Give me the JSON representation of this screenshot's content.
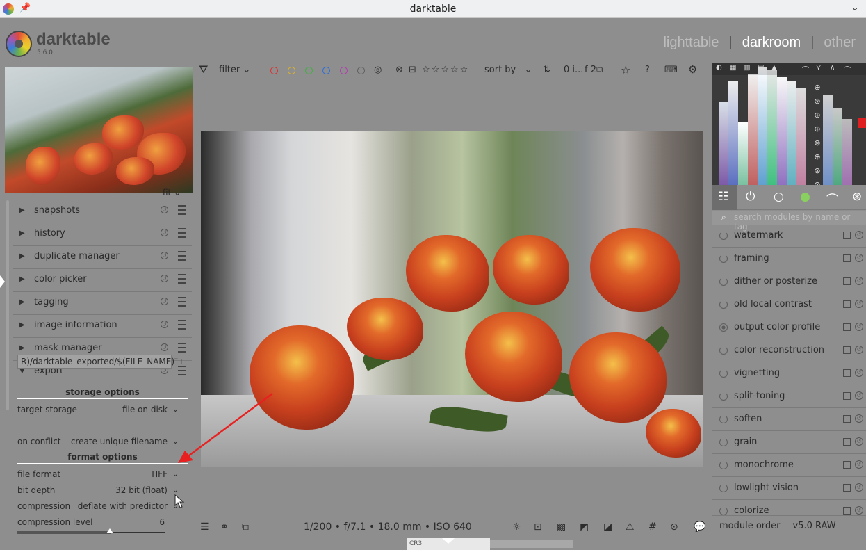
{
  "window": {
    "title": "darktable"
  },
  "app": {
    "brand": "darktable",
    "version": "5.6.0"
  },
  "views": {
    "lighttable": "lighttable",
    "darkroom": "darkroom",
    "other": "other",
    "separator": "|"
  },
  "thumbnail": {
    "zoom_label": "fit",
    "zoom_chevron": "⌄"
  },
  "left_modules": [
    {
      "label": "snapshots",
      "expanded": false
    },
    {
      "label": "history",
      "expanded": false
    },
    {
      "label": "duplicate manager",
      "expanded": false
    },
    {
      "label": "color picker",
      "expanded": false
    },
    {
      "label": "tagging",
      "expanded": false
    },
    {
      "label": "image information",
      "expanded": false
    },
    {
      "label": "mask manager",
      "expanded": false
    },
    {
      "label": "export",
      "expanded": true
    }
  ],
  "export": {
    "storage_title": "storage options",
    "target_storage_label": "target storage",
    "target_storage_value": "file on disk",
    "path_value": "R)/darktable_exported/$(FILE_NAME)",
    "on_conflict_label": "on conflict",
    "on_conflict_value": "create unique filename",
    "format_title": "format options",
    "file_format_label": "file format",
    "file_format_value": "TIFF",
    "bit_depth_label": "bit depth",
    "bit_depth_value": "32 bit (float)",
    "compression_label": "compression",
    "compression_value": "deflate with predictor",
    "compression_level_label": "compression level",
    "compression_level_value": "6"
  },
  "filterbar": {
    "filter_label": "filter",
    "sort_label": "sort by",
    "count_label": "0 i...",
    "group_label": "f 2",
    "color_labels": [
      "#e03030",
      "#d8b030",
      "#40b040",
      "#3070d8",
      "#b040b0",
      "#606060",
      "#404040"
    ]
  },
  "bottombar": {
    "exif": "1/200 • f/7.1 • 18.0 mm • ISO 640"
  },
  "filmstrip": {
    "tab_label": "CR3"
  },
  "module_search": {
    "placeholder": "search modules by name or tag"
  },
  "right_modules": [
    {
      "label": "watermark"
    },
    {
      "label": "framing"
    },
    {
      "label": "dither or posterize"
    },
    {
      "label": "old local contrast"
    },
    {
      "label": "output color profile"
    },
    {
      "label": "color reconstruction"
    },
    {
      "label": "vignetting"
    },
    {
      "label": "split-toning"
    },
    {
      "label": "soften"
    },
    {
      "label": "grain"
    },
    {
      "label": "monochrome"
    },
    {
      "label": "lowlight vision"
    },
    {
      "label": "colorize"
    }
  ],
  "module_order": {
    "label": "module order",
    "value": "v5.0 RAW"
  }
}
